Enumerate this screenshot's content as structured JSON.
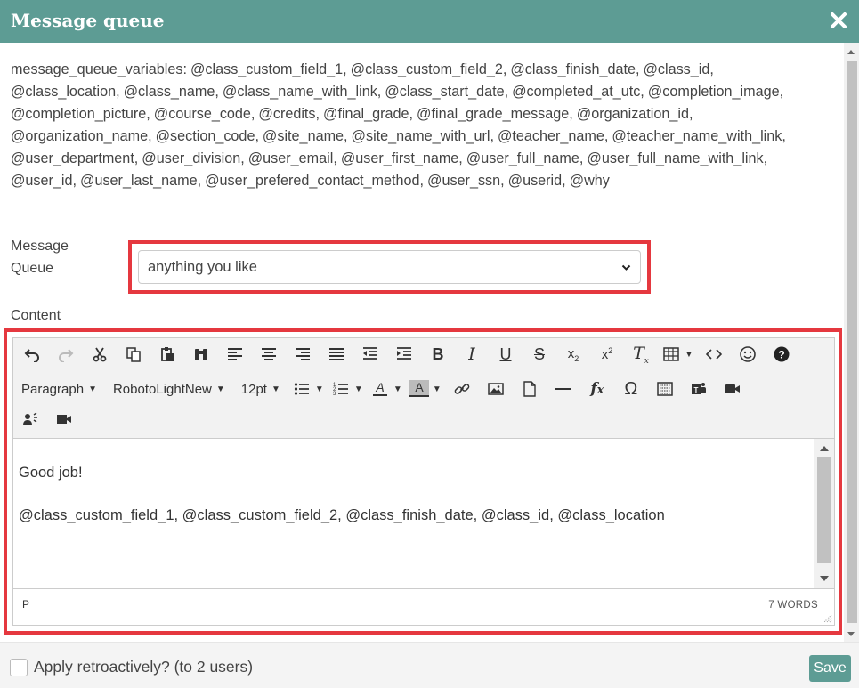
{
  "dialog": {
    "title": "Message queue"
  },
  "variables_text": "message_queue_variables: @class_custom_field_1, @class_custom_field_2, @class_finish_date, @class_id, @class_location, @class_name, @class_name_with_link, @class_start_date, @completed_at_utc, @completion_image, @completion_picture, @course_code, @credits, @final_grade, @final_grade_message, @organization_id, @organization_name, @section_code, @site_name, @site_name_with_url, @teacher_name, @teacher_name_with_link, @user_department, @user_division, @user_email, @user_first_name, @user_full_name, @user_full_name_with_link, @user_id, @user_last_name, @user_prefered_contact_method, @user_ssn, @userid, @why",
  "message_queue": {
    "label": "Message Queue",
    "selected": "anything you like"
  },
  "content": {
    "label": "Content"
  },
  "toolbar": {
    "format_menu": "Paragraph",
    "font_menu": "RobotoLightNew",
    "size_menu": "12pt"
  },
  "editor": {
    "paragraphs": [
      "Good job!",
      "@class_custom_field_1, @class_custom_field_2, @class_finish_date, @class_id, @class_location"
    ],
    "path": "P",
    "word_count": "7 WORDS"
  },
  "footer": {
    "checkbox_label": "Apply retroactively? (to 2 users)",
    "save_label": "Save"
  },
  "colors": {
    "header": "#5d9c94",
    "highlight": "#e5383f",
    "save": "#5d9c94"
  }
}
